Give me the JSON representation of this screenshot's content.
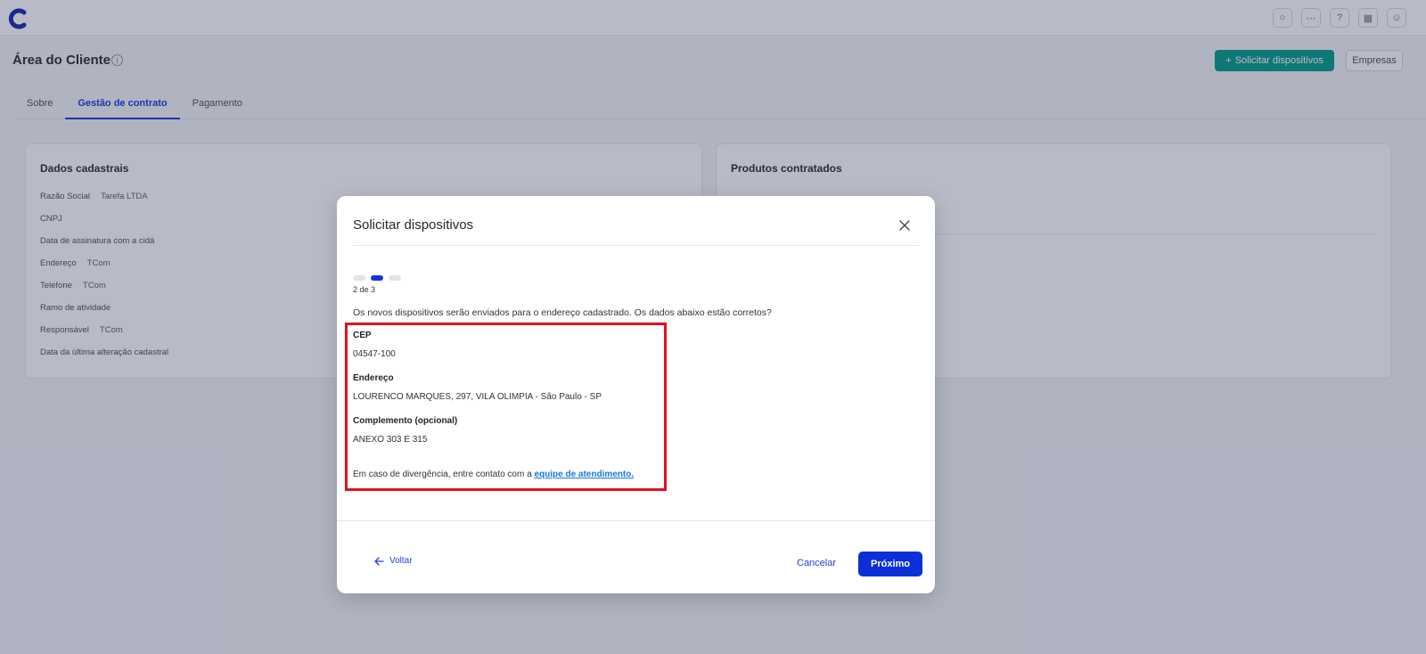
{
  "app": {
    "page_title": "Área do Cliente",
    "request_button": "Solicitar dispositivos",
    "companies_button": "Empresas",
    "tabs": [
      "Sobre",
      "Gestão de contrato",
      "Pagamento"
    ],
    "left_card": {
      "title": "Dados cadastrais",
      "rows": [
        {
          "label": "Razão Social",
          "value": "Tarefa LTDA"
        },
        {
          "label": "CNPJ",
          "value": ""
        },
        {
          "label": "Data de assinatura com a cidá",
          "value": ""
        },
        {
          "label": "Endereço",
          "value": "TCom"
        },
        {
          "label": "Telefone",
          "value": "TCom"
        },
        {
          "label": "Ramo de atividade",
          "value": ""
        },
        {
          "label": "Responsável",
          "value": "TCom"
        },
        {
          "label": "Data da última alteração cadastral",
          "value": ""
        }
      ]
    },
    "right_card": {
      "title": "Produtos contratados"
    }
  },
  "modal": {
    "title": "Solicitar dispositivos",
    "step_text": "2 de 3",
    "question": "Os novos dispositivos serão enviados para o endereço cadastrado. Os dados abaixo estão corretos?",
    "fields": {
      "cep_label": "CEP",
      "cep_value": "04547-100",
      "address_label": "Endereço",
      "address_value": "LOURENCO MARQUES, 297, VILA OLIMPIA - São Paulo - SP",
      "complement_label": "Complemento (opcional)",
      "complement_value": "ANEXO 303 E 315"
    },
    "note_prefix": "Em caso de divergência, entre contato com a",
    "note_link": "equipe de atendimento.",
    "back_label": "Voltar",
    "cancel_label": "Cancelar",
    "next_label": "Próximo"
  },
  "colors": {
    "primary": "#0b2fd8",
    "link": "#1877d8",
    "teal": "#0e9f8a",
    "highlight": "#e5101a"
  }
}
